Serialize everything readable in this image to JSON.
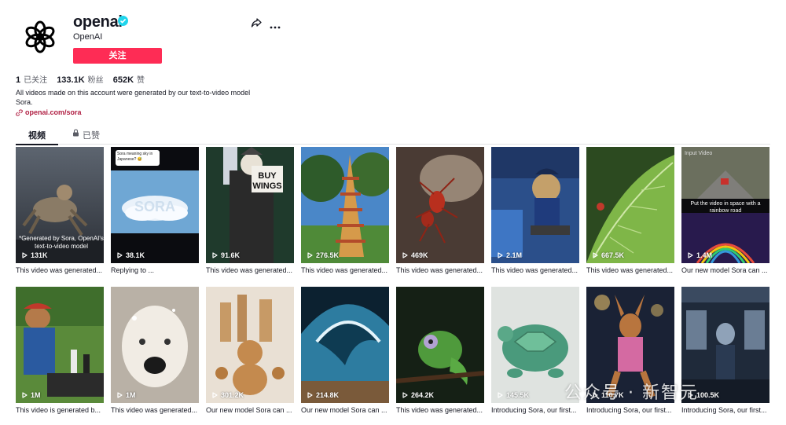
{
  "profile": {
    "username": "openai",
    "nickname": "OpenAI",
    "follow_label": "关注",
    "stats": [
      {
        "value": "1",
        "label": "已关注"
      },
      {
        "value": "133.1K",
        "label": "粉丝"
      },
      {
        "value": "652K",
        "label": "赞"
      }
    ],
    "bio": "All videos made on this account were generated by our text-to-video model Sora.",
    "link": "openai.com/sora"
  },
  "tabs": {
    "videos": "视频",
    "liked": "已赞"
  },
  "videos": [
    {
      "views": "131K",
      "caption": "This video was generated...",
      "overlay": "*Generated by Sora, OpenAI's text-to-video model"
    },
    {
      "views": "38.1K",
      "caption": "Replying to ...",
      "overlay": "Sora meaning sky in Japanese? 😅"
    },
    {
      "views": "91.6K",
      "caption": "This video was generated...",
      "overlay": "BUY WINGS"
    },
    {
      "views": "276.5K",
      "caption": "This video was generated...",
      "overlay": ""
    },
    {
      "views": "469K",
      "caption": "This video was generated...",
      "overlay": ""
    },
    {
      "views": "2.1M",
      "caption": "This video was generated...",
      "overlay": ""
    },
    {
      "views": "667.5K",
      "caption": "This video was generated...",
      "overlay": ""
    },
    {
      "views": "1.4M",
      "caption": "Our new model Sora can ...",
      "overlay": "Put the video in space with a rainbow road"
    },
    {
      "views": "1M",
      "caption": "This video is generated b...",
      "overlay": ""
    },
    {
      "views": "1M",
      "caption": "This video was generated...",
      "overlay": ""
    },
    {
      "views": "301.2K",
      "caption": "Our new model Sora can ...",
      "overlay": ""
    },
    {
      "views": "214.8K",
      "caption": "Our new model Sora can ...",
      "overlay": ""
    },
    {
      "views": "264.2K",
      "caption": "This video was generated...",
      "overlay": ""
    },
    {
      "views": "145.5K",
      "caption": "Introducing Sora, our first...",
      "overlay": ""
    },
    {
      "views": "110.7K",
      "caption": "Introducing Sora, our first...",
      "overlay": ""
    },
    {
      "views": "100.5K",
      "caption": "Introducing Sora, our first...",
      "overlay": ""
    }
  ],
  "thumb_input_label": "Input Video",
  "watermark": "公众号 · 新智元"
}
